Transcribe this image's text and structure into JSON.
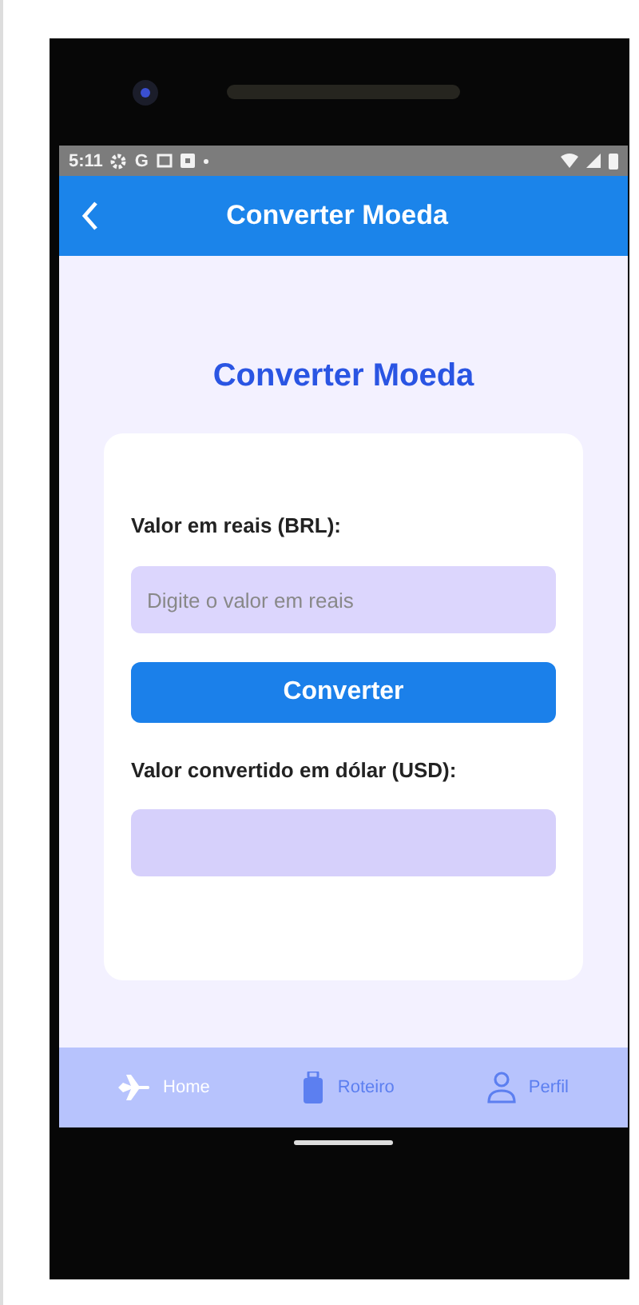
{
  "status_bar": {
    "time": "5:11",
    "app_letter": "G"
  },
  "header": {
    "title": "Converter Moeda"
  },
  "page": {
    "heading": "Converter Moeda",
    "form": {
      "input_label": "Valor em reais (BRL):",
      "input": {
        "placeholder": "Digite o valor em reais"
      },
      "button": "Converter",
      "output_label": "Valor convertido em dólar (USD):"
    }
  },
  "tab_bar": [
    {
      "label": "Home",
      "selected": true
    },
    {
      "label": "Roteiro",
      "selected": false
    },
    {
      "label": "Perfil",
      "selected": false
    }
  ]
}
